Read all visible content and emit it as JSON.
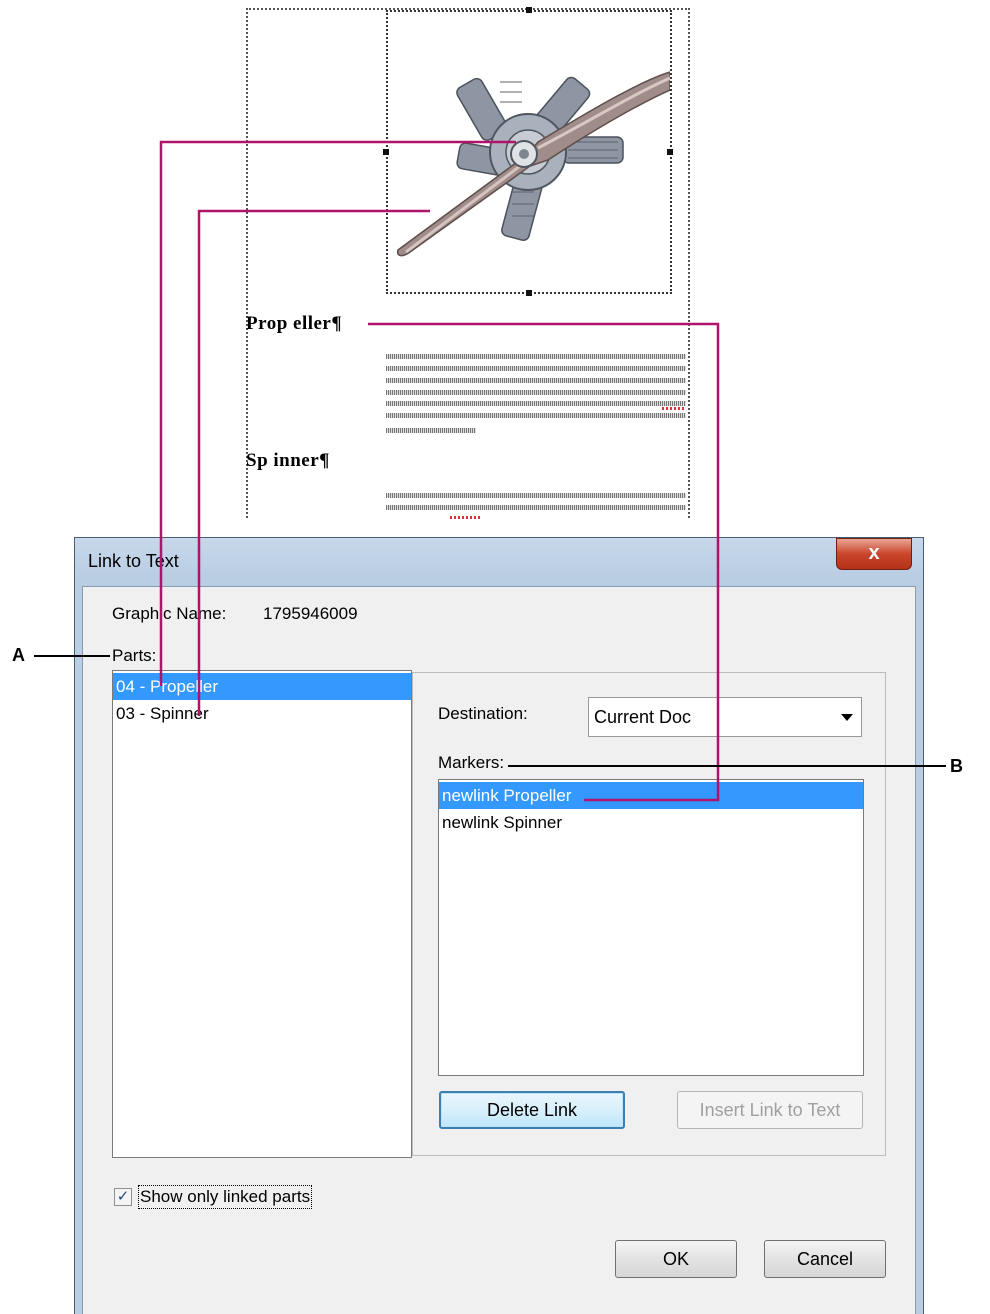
{
  "document": {
    "heading_1": "Prop eller¶",
    "heading_2": "Sp inner¶"
  },
  "dialog": {
    "title": "Link to Text",
    "close_glyph": "x",
    "graphic_name_label": "Graphic Name:",
    "graphic_name_value": "1795946009",
    "parts_label": "Parts:",
    "parts": [
      {
        "label": "04 - Propeller",
        "selected": true
      },
      {
        "label": "03 - Spinner",
        "selected": false
      }
    ],
    "destination_label": "Destination:",
    "destination_value": "Current Doc",
    "markers_label": "Markers:",
    "markers": [
      {
        "label": "newlink Propeller",
        "selected": true
      },
      {
        "label": "newlink Spinner",
        "selected": false
      }
    ],
    "delete_link_button": "Delete Link",
    "insert_link_button": "Insert Link to Text",
    "show_only_linked_label": "Show only linked parts",
    "show_only_linked_checked": true,
    "ok_button": "OK",
    "cancel_button": "Cancel"
  },
  "callouts": {
    "a": "A",
    "b": "B"
  },
  "colors": {
    "callout_line": "#b0136b",
    "selection": "#3399ff"
  }
}
